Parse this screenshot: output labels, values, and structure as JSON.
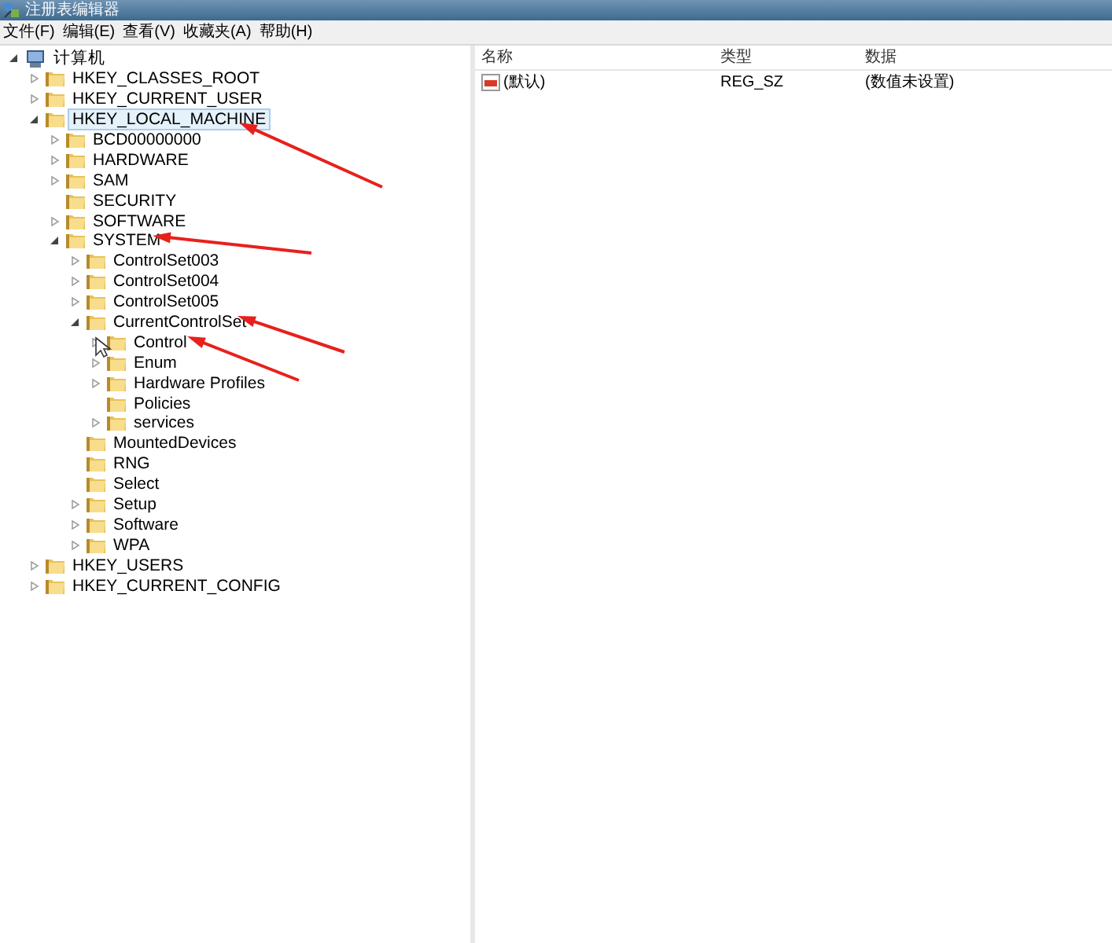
{
  "window": {
    "title": "注册表编辑器"
  },
  "menu": [
    "文件(F)",
    "编辑(E)",
    "查看(V)",
    "收藏夹(A)",
    "帮助(H)"
  ],
  "tree": {
    "label": "计算机",
    "expanded": true,
    "has_children": true,
    "selected": false,
    "kind": "computer",
    "children": [
      {
        "label": "HKEY_CLASSES_ROOT",
        "expanded": false,
        "has_children": true,
        "selected": false
      },
      {
        "label": "HKEY_CURRENT_USER",
        "expanded": false,
        "has_children": true,
        "selected": false
      },
      {
        "label": "HKEY_LOCAL_MACHINE",
        "expanded": true,
        "has_children": true,
        "selected": true,
        "children": [
          {
            "label": "BCD00000000",
            "expanded": false,
            "has_children": true,
            "selected": false
          },
          {
            "label": "HARDWARE",
            "expanded": false,
            "has_children": true,
            "selected": false
          },
          {
            "label": "SAM",
            "expanded": false,
            "has_children": true,
            "selected": false
          },
          {
            "label": "SECURITY",
            "has_children": false,
            "selected": false
          },
          {
            "label": "SOFTWARE",
            "expanded": false,
            "has_children": true,
            "selected": false
          },
          {
            "label": "SYSTEM",
            "expanded": true,
            "has_children": true,
            "selected": false,
            "children": [
              {
                "label": "ControlSet003",
                "expanded": false,
                "has_children": true,
                "selected": false
              },
              {
                "label": "ControlSet004",
                "expanded": false,
                "has_children": true,
                "selected": false
              },
              {
                "label": "ControlSet005",
                "expanded": false,
                "has_children": true,
                "selected": false
              },
              {
                "label": "CurrentControlSet",
                "expanded": true,
                "has_children": true,
                "selected": false,
                "children": [
                  {
                    "label": "Control",
                    "expanded": false,
                    "has_children": true,
                    "selected": false
                  },
                  {
                    "label": "Enum",
                    "expanded": false,
                    "has_children": true,
                    "selected": false
                  },
                  {
                    "label": "Hardware Profiles",
                    "expanded": false,
                    "has_children": true,
                    "selected": false
                  },
                  {
                    "label": "Policies",
                    "has_children": false,
                    "selected": false
                  },
                  {
                    "label": "services",
                    "expanded": false,
                    "has_children": true,
                    "selected": false
                  }
                ]
              },
              {
                "label": "MountedDevices",
                "has_children": false,
                "selected": false
              },
              {
                "label": "RNG",
                "has_children": false,
                "selected": false
              },
              {
                "label": "Select",
                "has_children": false,
                "selected": false
              },
              {
                "label": "Setup",
                "expanded": false,
                "has_children": true,
                "selected": false
              },
              {
                "label": "Software",
                "expanded": false,
                "has_children": true,
                "selected": false
              },
              {
                "label": "WPA",
                "expanded": false,
                "has_children": true,
                "selected": false
              }
            ]
          }
        ]
      },
      {
        "label": "HKEY_USERS",
        "expanded": false,
        "has_children": true,
        "selected": false
      },
      {
        "label": "HKEY_CURRENT_CONFIG",
        "expanded": false,
        "has_children": true,
        "selected": false
      }
    ]
  },
  "values": {
    "columns": [
      "名称",
      "类型",
      "数据"
    ],
    "rows": [
      {
        "name": "(默认)",
        "type": "REG_SZ",
        "data": "(数值未设置)",
        "kind": "string"
      }
    ]
  }
}
